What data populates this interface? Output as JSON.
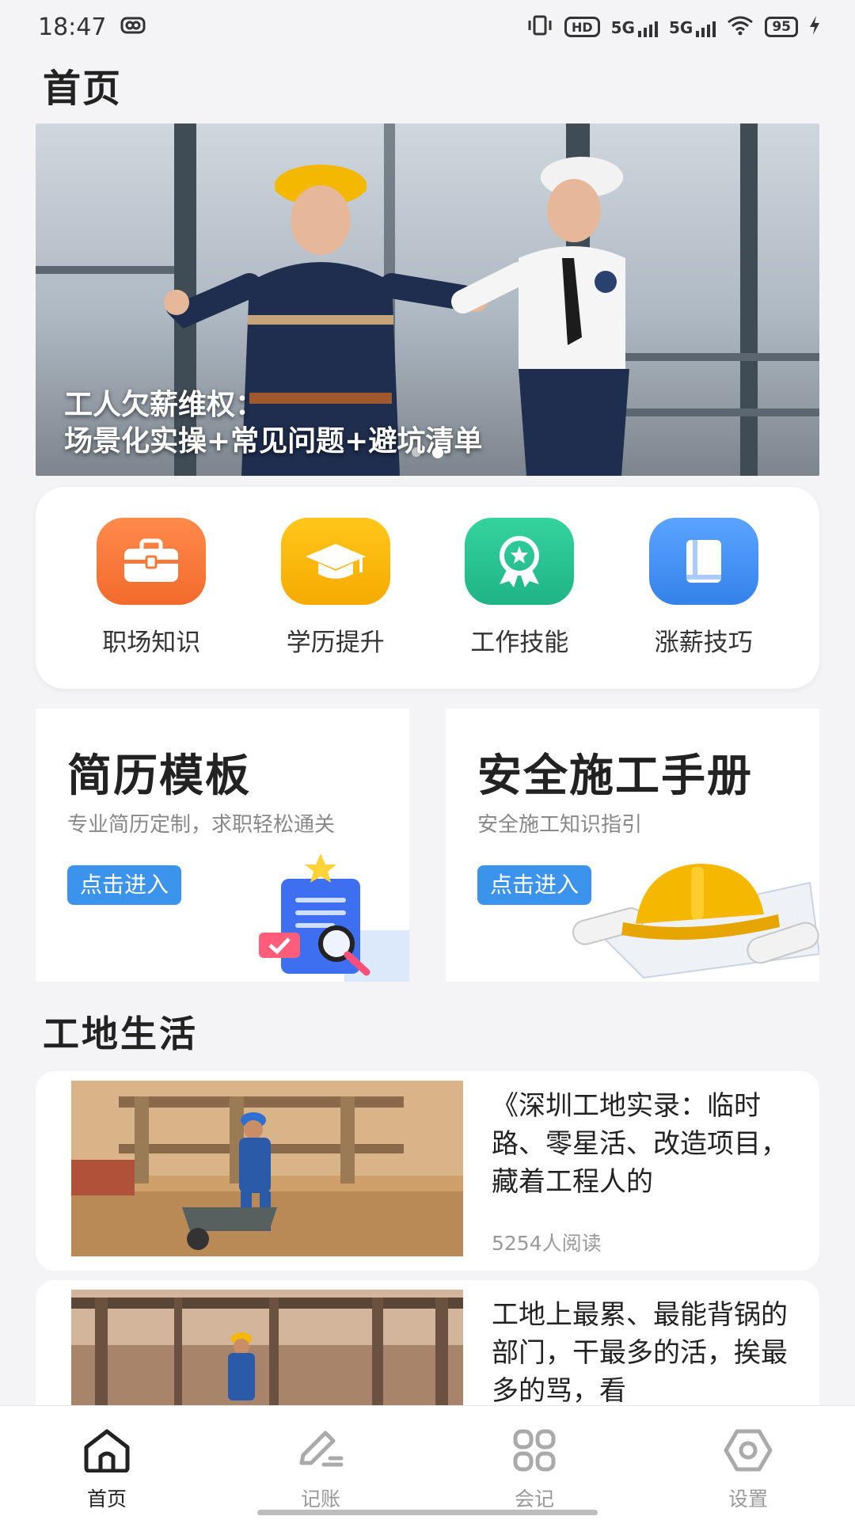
{
  "status_bar": {
    "time": "18:47",
    "hd_label": "HD",
    "net1": "5G",
    "net2": "5G",
    "battery": "95"
  },
  "page_title": "首页",
  "banner": {
    "caption_line1": "工人欠薪维权：",
    "caption_line2": "场景化实操+常见问题+避坑清单"
  },
  "quick_actions": [
    {
      "label": "职场知识",
      "icon": "briefcase-icon",
      "color": "#f7743c"
    },
    {
      "label": "学历提升",
      "icon": "graduation-cap-icon",
      "color": "#f7b500"
    },
    {
      "label": "工作技能",
      "icon": "award-ribbon-icon",
      "color": "#25c28f"
    },
    {
      "label": "涨薪技巧",
      "icon": "book-icon",
      "color": "#3d8ff0"
    }
  ],
  "features": {
    "resume": {
      "title": "简历模板",
      "subtitle": "专业简历定制，求职轻松通关",
      "button": "点击进入"
    },
    "safety": {
      "title": "安全施工手册",
      "subtitle": "安全施工知识指引",
      "button": "点击进入"
    }
  },
  "section_title": "工地生活",
  "articles": [
    {
      "title": "《深圳工地实录：临时路、零星活、改造项目，藏着工程人的",
      "reads": "5254人阅读"
    },
    {
      "title": "工地上最累、最能背锅的部门，干最多的活，挨最多的骂，看",
      "reads": ""
    }
  ],
  "bottom_nav": [
    {
      "label": "首页",
      "icon": "home-icon"
    },
    {
      "label": "记账",
      "icon": "pen-icon"
    },
    {
      "label": "会记",
      "icon": "grid-icon"
    },
    {
      "label": "设置",
      "icon": "hexagon-settings-icon"
    }
  ]
}
